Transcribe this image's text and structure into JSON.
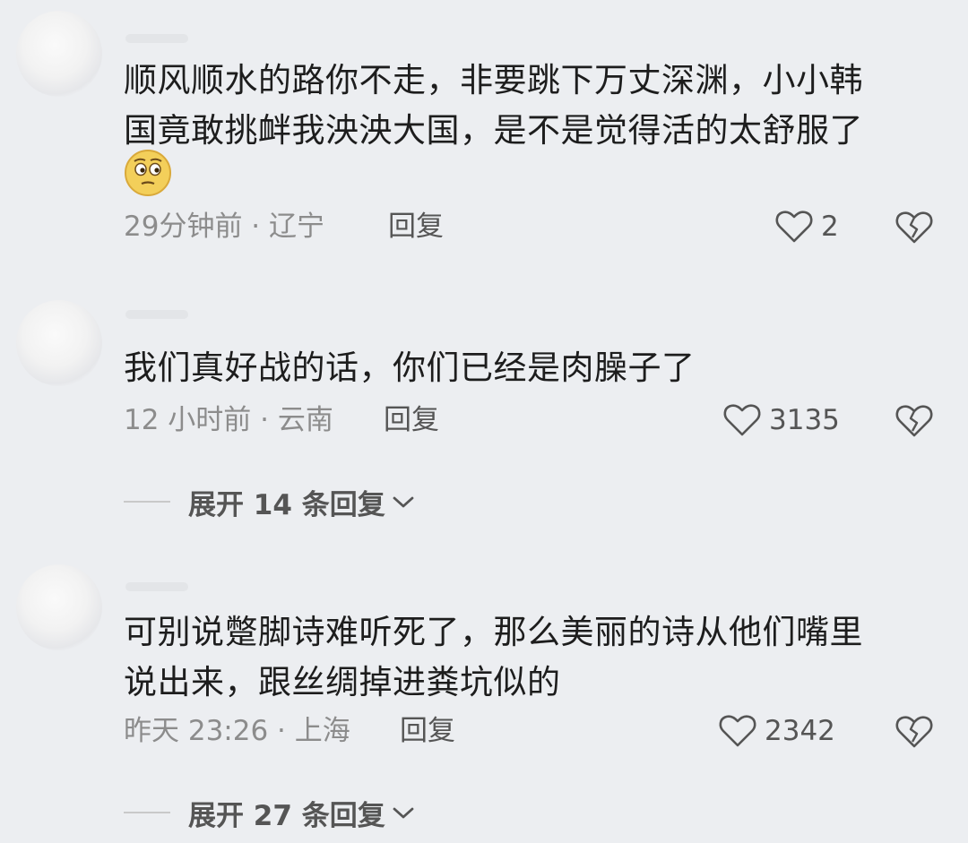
{
  "comments": [
    {
      "text_line1": "顺风顺水的路你不走，非要跳下万丈深渊，小小韩",
      "text_line2": "国竟敢挑衅我泱泱大国，是不是觉得活的太舒服了",
      "emoji": "smirk-emoji",
      "meta": "29分钟前 · 辽宁",
      "reply_label": "回复",
      "likes": "2"
    },
    {
      "text_line1": "我们真好战的话，你们已经是肉臊子了",
      "meta": "12 小时前 · 云南",
      "reply_label": "回复",
      "likes": "3135",
      "expand_label": "展开 14 条回复"
    },
    {
      "text_line1": "可别说蹩脚诗难听死了，那么美丽的诗从他们嘴里",
      "text_line2": "说出来，跟丝绸掉进粪坑似的",
      "meta": "昨天 23:26 · 上海",
      "reply_label": "回复",
      "likes": "2342",
      "expand_label": "展开 27 条回复"
    }
  ],
  "icons": {
    "like": "heart-outline-icon",
    "dislike": "broken-heart-icon",
    "expand": "chevron-down-icon"
  },
  "colors": {
    "background": "#eceef1",
    "text": "#1d1d1d",
    "meta": "#8c8c8c",
    "icon": "#555555"
  }
}
